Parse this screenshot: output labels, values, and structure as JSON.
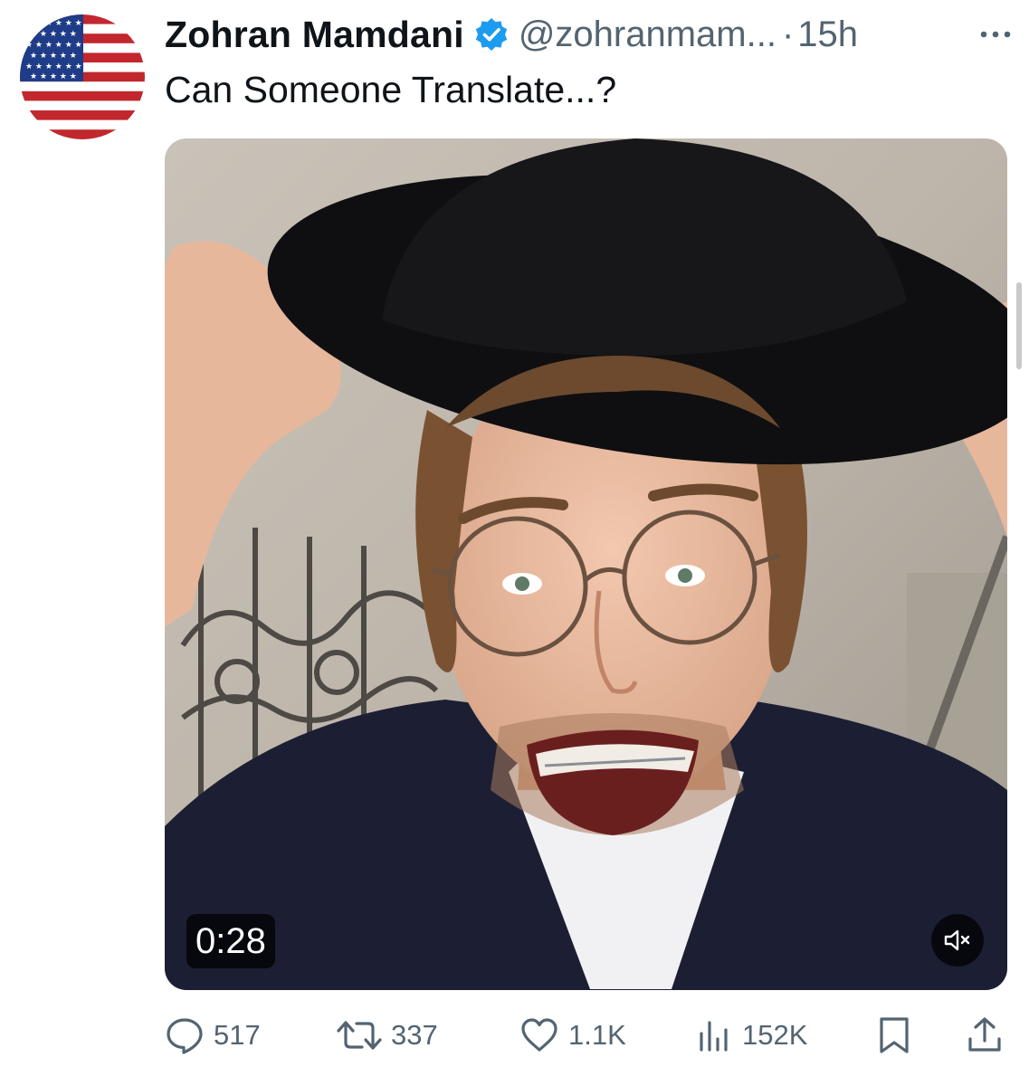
{
  "post": {
    "author": {
      "display_name": "Zohran Mamdani",
      "handle": "@zohranmam...",
      "verified": true,
      "avatar_icon": "us-flag-icon"
    },
    "separator": "·",
    "timestamp": "15h",
    "text": "Can Someone Translate...?",
    "media": {
      "type": "video",
      "duration": "0:28",
      "muted": true
    },
    "stats": {
      "replies": "517",
      "reposts": "337",
      "likes": "1.1K",
      "views": "152K"
    }
  },
  "colors": {
    "text_primary": "#0f1419",
    "text_secondary": "#536471",
    "verified_blue": "#1d9bf0",
    "background": "#ffffff"
  }
}
